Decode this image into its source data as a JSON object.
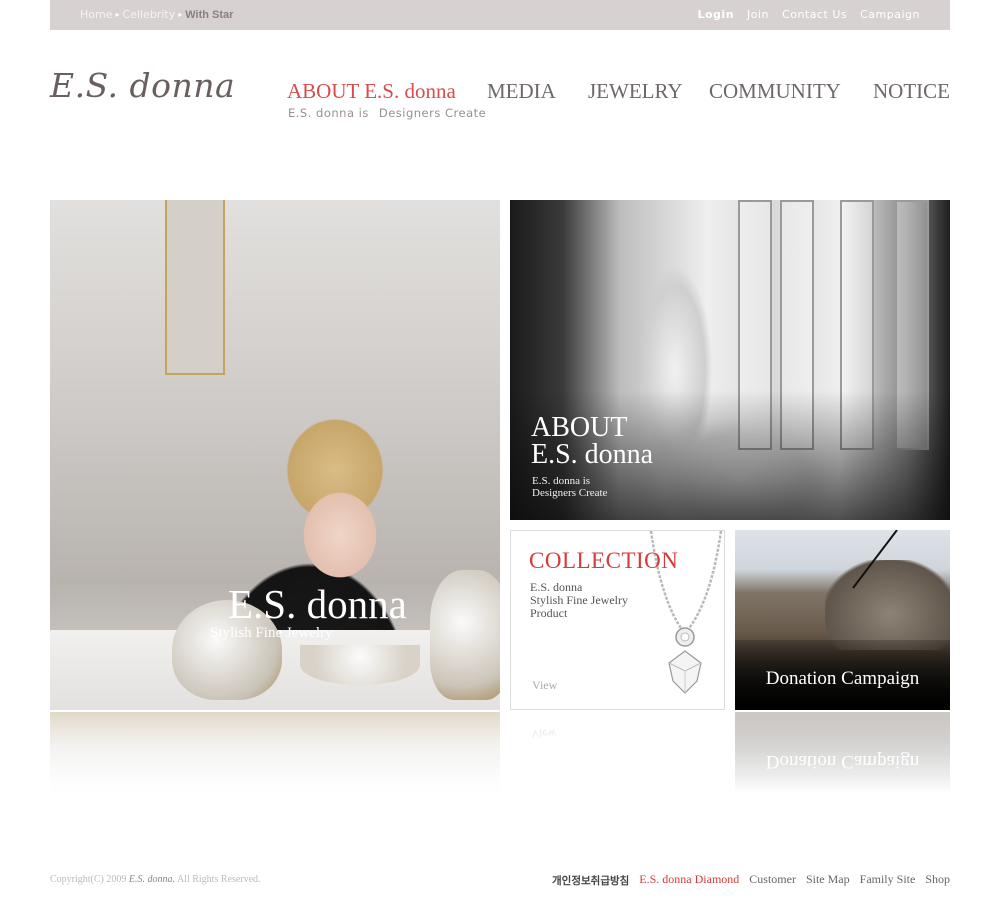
{
  "topbar": {
    "breadcrumb": [
      "Home",
      "Cellebrity",
      "With Star"
    ],
    "links": [
      "Login",
      "Join",
      "Contact Us",
      "Campaign"
    ]
  },
  "logo": "E.S. donna",
  "nav": {
    "items": [
      "ABOUT E.S. donna",
      "MEDIA",
      "JEWELRY",
      "COMMUNITY",
      "NOTICE"
    ],
    "sub": [
      "E.S. donna is",
      "Designers Create"
    ]
  },
  "hero": {
    "title": "E.S. donna",
    "subtitle": "Stylish Fine Jewelry"
  },
  "about": {
    "title_line1": "ABOUT",
    "title_line2": "E.S. donna",
    "sub_line1": "E.S. donna is",
    "sub_line2": "Designers Create"
  },
  "collection": {
    "title": "COLLECTION",
    "desc_line1": "E.S. donna",
    "desc_line2": "Stylish Fine Jewelry",
    "desc_line3": "Product",
    "view": "View"
  },
  "donation": {
    "title": "Donation Campaign"
  },
  "footer": {
    "copyright_prefix": "Copyright(C) 2009",
    "copyright_brand": "E.S. donna.",
    "copyright_suffix": "All Rights Reserved.",
    "links": [
      "개인정보취급방침",
      "E.S. donna Diamond",
      "Customer",
      "Site Map",
      "Family Site",
      "Shop"
    ]
  },
  "colors": {
    "accent": "#d84c4c",
    "topbar": "#d7d1d1",
    "nav": "#6f6868"
  }
}
